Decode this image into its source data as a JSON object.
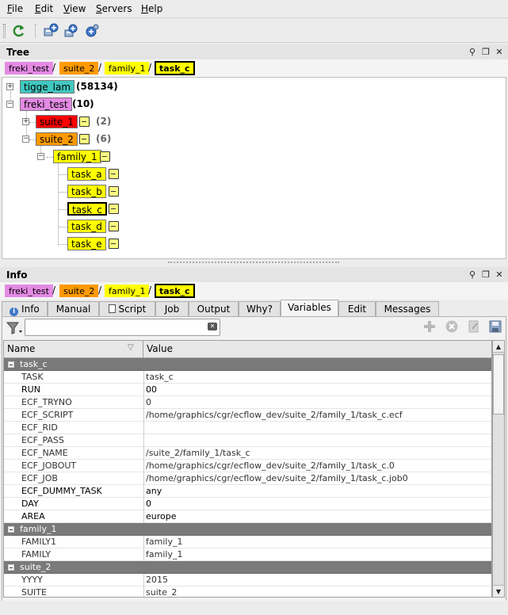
{
  "menubar": {
    "items": [
      {
        "label": "File",
        "mnemonic": "F",
        "rest": "ile"
      },
      {
        "label": "Edit",
        "mnemonic": "E",
        "rest": "dit"
      },
      {
        "label": "View",
        "mnemonic": "V",
        "rest": "iew"
      },
      {
        "label": "Servers",
        "mnemonic": "S",
        "rest": "ervers"
      },
      {
        "label": "Help",
        "mnemonic": "H",
        "rest": "elp"
      }
    ]
  },
  "toolbar": {
    "icons": [
      "refresh-icon",
      "add-server-icon",
      "new-server-icon",
      "manage-servers-icon"
    ]
  },
  "tree_panel": {
    "title": "Tree",
    "breadcrumb": [
      "freki_test",
      "suite_2",
      "family_1",
      "task_c"
    ],
    "separator": "/",
    "nodes": [
      {
        "label": "tigge_lam",
        "count": "(58134)",
        "color": "#40c8c0"
      },
      {
        "label": "freki_test",
        "count": "(10)",
        "color": "#e48ae4"
      },
      {
        "label": "suite_1",
        "count": "(2)",
        "color": "#ff0000"
      },
      {
        "label": "suite_2",
        "count": "(6)",
        "color": "#ff9a00"
      },
      {
        "label": "family_1",
        "color": "#ffff00"
      },
      {
        "label": "task_a",
        "color": "#ffff00"
      },
      {
        "label": "task_b",
        "color": "#ffff00"
      },
      {
        "label": "task_c",
        "color": "#ffff00",
        "selected": true
      },
      {
        "label": "task_d",
        "color": "#ffff00"
      },
      {
        "label": "task_e",
        "color": "#ffff00"
      }
    ],
    "expander_plus": "+",
    "expander_minus": "−"
  },
  "info_panel": {
    "title": "Info",
    "breadcrumb": [
      "freki_test",
      "suite_2",
      "family_1",
      "task_c"
    ],
    "tabs": [
      "Info",
      "Manual",
      "Script",
      "Job",
      "Output",
      "Why?",
      "Variables",
      "Edit",
      "Messages"
    ],
    "active_tab": "Variables",
    "search": {
      "value": "",
      "placeholder": ""
    },
    "table": {
      "headers": [
        "Name",
        "Value"
      ],
      "groups": [
        {
          "name": "task_c",
          "rows": [
            {
              "name": "TASK",
              "value": "task_c",
              "kind": "gen"
            },
            {
              "name": "RUN",
              "value": "00",
              "kind": "user"
            },
            {
              "name": "ECF_TRYNO",
              "value": "0",
              "kind": "gen"
            },
            {
              "name": "ECF_SCRIPT",
              "value": "/home/graphics/cgr/ecflow_dev/suite_2/family_1/task_c.ecf",
              "kind": "gen"
            },
            {
              "name": "ECF_RID",
              "value": "",
              "kind": "gen"
            },
            {
              "name": "ECF_PASS",
              "value": "",
              "kind": "gen"
            },
            {
              "name": "ECF_NAME",
              "value": "/suite_2/family_1/task_c",
              "kind": "gen"
            },
            {
              "name": "ECF_JOBOUT",
              "value": "/home/graphics/cgr/ecflow_dev/suite_2/family_1/task_c.0",
              "kind": "gen"
            },
            {
              "name": "ECF_JOB",
              "value": "/home/graphics/cgr/ecflow_dev/suite_2/family_1/task_c.job0",
              "kind": "gen"
            },
            {
              "name": "ECF_DUMMY_TASK",
              "value": "any",
              "kind": "user"
            },
            {
              "name": "DAY",
              "value": "0",
              "kind": "user"
            },
            {
              "name": "AREA",
              "value": "europe",
              "kind": "user"
            }
          ]
        },
        {
          "name": "family_1",
          "rows": [
            {
              "name": "FAMILY1",
              "value": "family_1",
              "kind": "gen"
            },
            {
              "name": "FAMILY",
              "value": "family_1",
              "kind": "gen"
            }
          ]
        },
        {
          "name": "suite_2",
          "rows": [
            {
              "name": "YYYY",
              "value": "2015",
              "kind": "gen"
            },
            {
              "name": "SUITE",
              "value": "suite_2",
              "kind": "gen"
            }
          ]
        }
      ]
    }
  },
  "dock_icons": [
    "wrench-icon",
    "float-icon",
    "close-icon"
  ],
  "dock_glyphs": [
    "⚲",
    "❐",
    "✕"
  ],
  "colors": {
    "suite_complete": "#ff9a00",
    "aborted": "#ff0000",
    "active": "#ffff00",
    "queued_server": "#40c8c0",
    "suite_freki": "#e48ae4",
    "group_header": "#7a7a7a"
  }
}
